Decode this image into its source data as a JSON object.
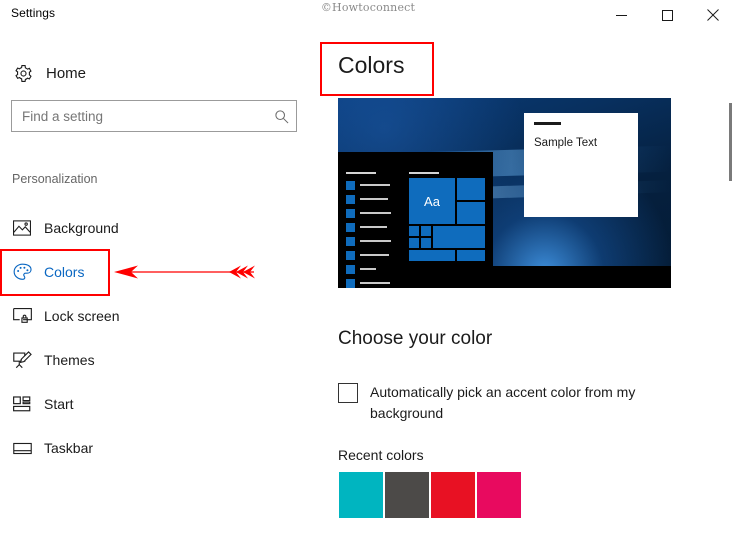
{
  "window": {
    "app_title": "Settings",
    "watermark": "©Howtoconnect",
    "controls": {
      "minimize": "minimize-icon",
      "maximize": "maximize-icon",
      "close": "close-icon"
    }
  },
  "sidebar": {
    "home_label": "Home",
    "home_icon": "gear-icon",
    "search": {
      "value": "",
      "placeholder": "Find a setting",
      "icon": "search-icon"
    },
    "group_title": "Personalization",
    "items": [
      {
        "label": "Background",
        "icon": "picture-icon",
        "selected": false
      },
      {
        "label": "Colors",
        "icon": "palette-icon",
        "selected": true
      },
      {
        "label": "Lock screen",
        "icon": "lock-screen-icon",
        "selected": false
      },
      {
        "label": "Themes",
        "icon": "themes-icon",
        "selected": false
      },
      {
        "label": "Start",
        "icon": "start-tiles-icon",
        "selected": false
      },
      {
        "label": "Taskbar",
        "icon": "taskbar-icon",
        "selected": false
      }
    ]
  },
  "main": {
    "page_title": "Colors",
    "preview": {
      "tile_letter": "Aa",
      "sample_window_text": "Sample Text"
    },
    "section_title": "Choose your color",
    "auto_accent": {
      "label": "Automatically pick an accent color from my background",
      "checked": false
    },
    "recent_colors": {
      "title": "Recent colors",
      "swatches": [
        {
          "name": "cyan",
          "hex": "#00B5C0"
        },
        {
          "name": "dark-gray",
          "hex": "#4C4A48"
        },
        {
          "name": "red",
          "hex": "#E81123"
        },
        {
          "name": "pink",
          "hex": "#E80A5F"
        }
      ]
    }
  },
  "annotations": {
    "highlight_color": "#FF0000",
    "arrow_color": "#FF0000",
    "accent_color": "#0A67C2"
  }
}
